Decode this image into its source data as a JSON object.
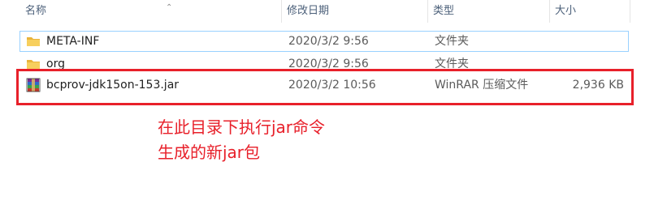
{
  "columns": {
    "name": "名称",
    "date": "修改日期",
    "type": "类型",
    "size": "大小"
  },
  "files": [
    {
      "name": "META-INF",
      "date": "2020/3/2 9:56",
      "type": "文件夹",
      "size": "",
      "icon": "folder-icon"
    },
    {
      "name": "org",
      "date": "2020/3/2 9:56",
      "type": "文件夹",
      "size": "",
      "icon": "folder-icon"
    },
    {
      "name": "bcprov-jdk15on-153.jar",
      "date": "2020/3/2 10:56",
      "type": "WinRAR 压缩文件",
      "size": "2,936 KB",
      "icon": "winrar-archive-icon"
    }
  ],
  "annotation": {
    "line1": "在此目录下执行jar命令",
    "line2": "生成的新jar包",
    "color": "#e8202a"
  },
  "colors": {
    "folder": "#f2c146",
    "selection_border": "#99d1ff",
    "header_text": "#4c607a"
  }
}
